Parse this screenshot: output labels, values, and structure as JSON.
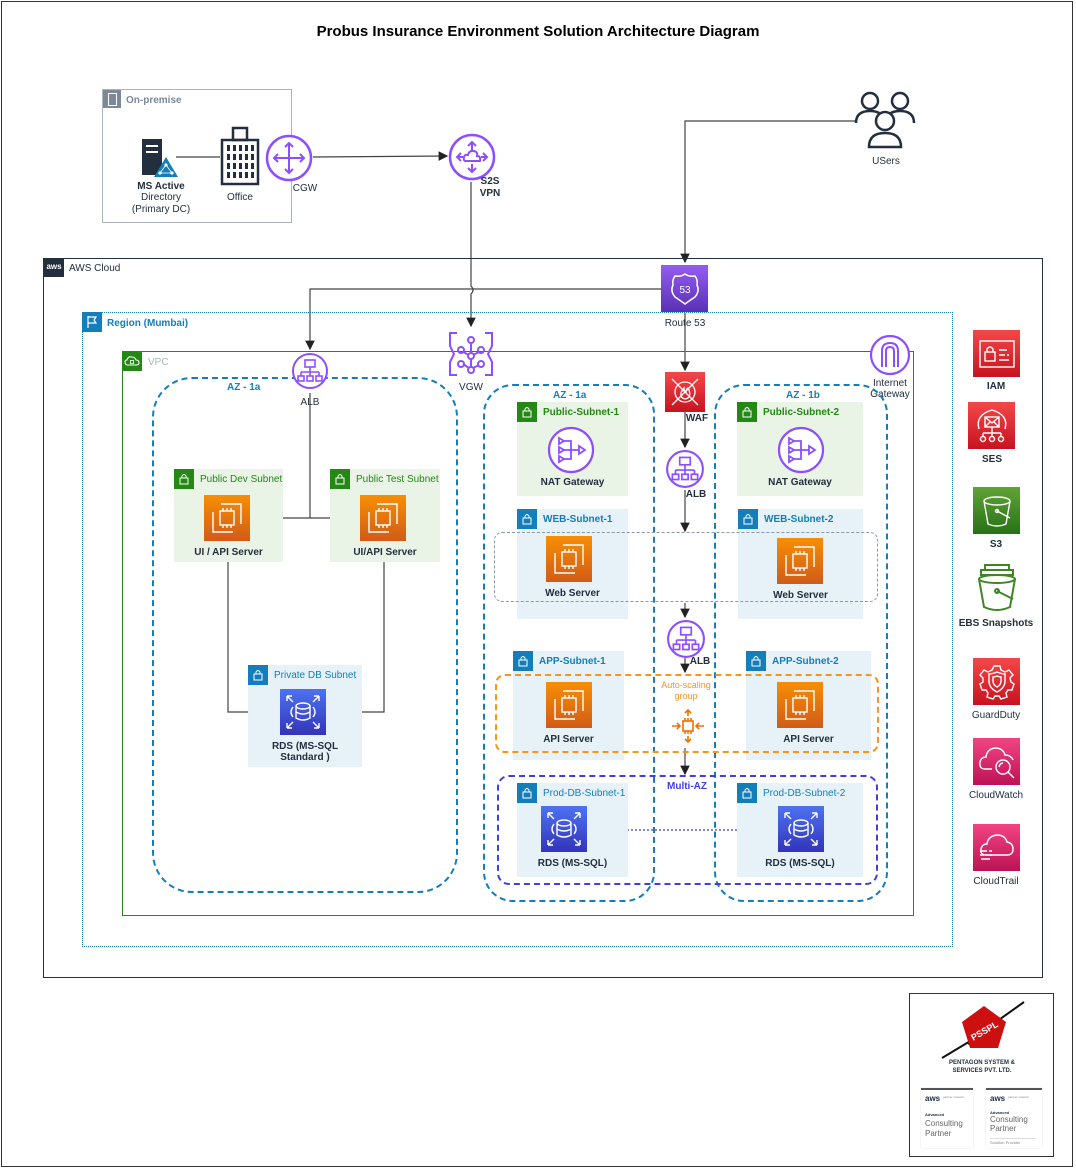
{
  "title": "Probus Insurance Environment Solution Architecture Diagram",
  "on_premise": {
    "group_label": "On-premise",
    "ad_label_line1": "MS Active",
    "ad_label_line2": "Directory",
    "ad_label_line3": "(Primary DC)",
    "office_label": "Office",
    "cgw_label": "CGW"
  },
  "vpn": {
    "line1": "S2S",
    "line2": "VPN"
  },
  "users_label": "USers",
  "aws_cloud_label": "AWS Cloud",
  "aws_logo_text": "aws",
  "region_label": "Region (Mumbai)",
  "vpc_label": "VPC",
  "route53_label": "Route 53",
  "route53_badge": "53",
  "vgw_label": "VGW",
  "igw_label_line1": "Internet",
  "igw_label_line2": "Gateway",
  "left_env": {
    "az_label": "AZ - 1a",
    "alb_label": "ALB",
    "dev_subnet": "Public Dev Subnet",
    "dev_server": "UI / API Server",
    "test_subnet": "Public Test Subnet",
    "test_server": "UI/API Server",
    "db_subnet": "Private DB Subnet",
    "db_line1": "RDS (MS-SQL",
    "db_line2": "Standard )"
  },
  "prod": {
    "az1_label": "AZ - 1a",
    "az2_label": "AZ - 1b",
    "waf_label": "WAF",
    "alb1_label": "ALB",
    "alb2_label": "ALB",
    "public_subnet_1": "Public-Subnet-1",
    "public_subnet_2": "Public-Subnet-2",
    "nat1": "NAT Gateway",
    "nat2": "NAT Gateway",
    "web_subnet_1": "WEB-Subnet-1",
    "web_subnet_2": "WEB-Subnet-2",
    "web1": "Web Server",
    "web2": "Web Server",
    "app_subnet_1": "APP-Subnet-1",
    "app_subnet_2": "APP-Subnet-2",
    "api1": "API Server",
    "api2": "API Server",
    "asg_line1": "Auto-scaling",
    "asg_line2": "group",
    "multi_az": "Multi-AZ",
    "db_subnet_1": "Prod-DB-Subnet-1",
    "db_subnet_2": "Prod-DB-Subnet-2",
    "rds1": "RDS (MS-SQL)",
    "rds2": "RDS (MS-SQL)"
  },
  "services": [
    {
      "label": "IAM"
    },
    {
      "label": "SES"
    },
    {
      "label": "S3"
    },
    {
      "label": "EBS Snapshots"
    },
    {
      "label": "GuardDuty"
    },
    {
      "label": "CloudWatch"
    },
    {
      "label": "CloudTrail"
    }
  ],
  "partner": {
    "logo_text": "PSSPL",
    "company_line1": "PENTAGON SYSTEM &",
    "company_line2": "SERVICES PVT. LTD.",
    "badge1": {
      "aws": "aws",
      "network": "partner network",
      "tier": "Advanced",
      "line1": "Consulting",
      "line2": "Partner",
      "note": ""
    },
    "badge2": {
      "aws": "aws",
      "network": "partner network",
      "tier": "Advanced",
      "line1": "Consulting",
      "line2": "Partner",
      "note": "Solution Provider"
    }
  },
  "colors": {
    "aws_purple": "#8c4fff",
    "region_blue": "#147eba",
    "vpc_green": "#248814",
    "ec2_orange": "#ed7100",
    "asg_orange": "#f7941d",
    "multi_az_blue": "#3f3fdd",
    "security_red": "#dd344c",
    "mgmt_pink": "#e7157b"
  }
}
